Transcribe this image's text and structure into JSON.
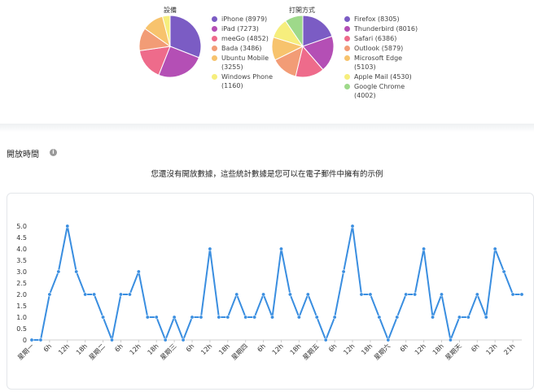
{
  "devices": {
    "title": "設備",
    "items": [
      {
        "label": "iPhone (8979)",
        "value": 8979,
        "color": "#7b5cc4"
      },
      {
        "label": "iPad (7273)",
        "value": 7273,
        "color": "#b44fb5"
      },
      {
        "label": "meeGo (4852)",
        "value": 4852,
        "color": "#ee6b8b"
      },
      {
        "label": "Bada (3486)",
        "value": 3486,
        "color": "#f29c76"
      },
      {
        "label": "Ubuntu Mobile (3255)",
        "value": 3255,
        "color": "#f7c36d"
      },
      {
        "label": "Windows Phone (1160)",
        "value": 1160,
        "color": "#f6ee7d"
      }
    ]
  },
  "clients": {
    "title": "打開方式",
    "items": [
      {
        "label": "Firefox (8305)",
        "value": 8305,
        "color": "#7b5cc4"
      },
      {
        "label": "Thunderbird (8016)",
        "value": 8016,
        "color": "#b44fb5"
      },
      {
        "label": "Safari (6386)",
        "value": 6386,
        "color": "#ee6b8b"
      },
      {
        "label": "Outlook (5879)",
        "value": 5879,
        "color": "#f29c76"
      },
      {
        "label": "Microsoft Edge (5103)",
        "value": 5103,
        "color": "#f7c36d"
      },
      {
        "label": "Apple Mail (4530)",
        "value": 4530,
        "color": "#f6ee7d"
      },
      {
        "label": "Google Chrome (4002)",
        "value": 4002,
        "color": "#9ed98a"
      }
    ]
  },
  "section": {
    "title": "開放時間",
    "info_icon": "info-icon",
    "notice": "您還沒有開放數據，這些統計數據是您可以在電子郵件中擁有的示例"
  },
  "chart_data": {
    "type": "line",
    "color": "#3a8ee0",
    "ylim": [
      0,
      5
    ],
    "yticks": [
      "0",
      "0.5",
      "1.0",
      "1.5",
      "2.0",
      "2.5",
      "3.0",
      "3.5",
      "4.0",
      "4.5",
      "5.0"
    ],
    "xtick_labels": [
      "星期一",
      "6h",
      "12h",
      "18h",
      "星期二",
      "6h",
      "12h",
      "18h",
      "星期三",
      "6h",
      "12h",
      "18h",
      "星期四",
      "6h",
      "12h",
      "18h",
      "星期五",
      "6h",
      "12h",
      "18h",
      "星期六",
      "6h",
      "12h",
      "18h",
      "星期天",
      "6h",
      "12h",
      "21h"
    ],
    "values": [
      0,
      0,
      2,
      3,
      5,
      3,
      2,
      2,
      1,
      0,
      2,
      2,
      3,
      1,
      1,
      0,
      1,
      0,
      1,
      1,
      4,
      1,
      1,
      2,
      1,
      1,
      2,
      1,
      4,
      2,
      1,
      2,
      1,
      0,
      1,
      3,
      5,
      2,
      2,
      1,
      0,
      1,
      2,
      2,
      4,
      1,
      2,
      0,
      1,
      1,
      2,
      1,
      4,
      3,
      2,
      2
    ]
  }
}
